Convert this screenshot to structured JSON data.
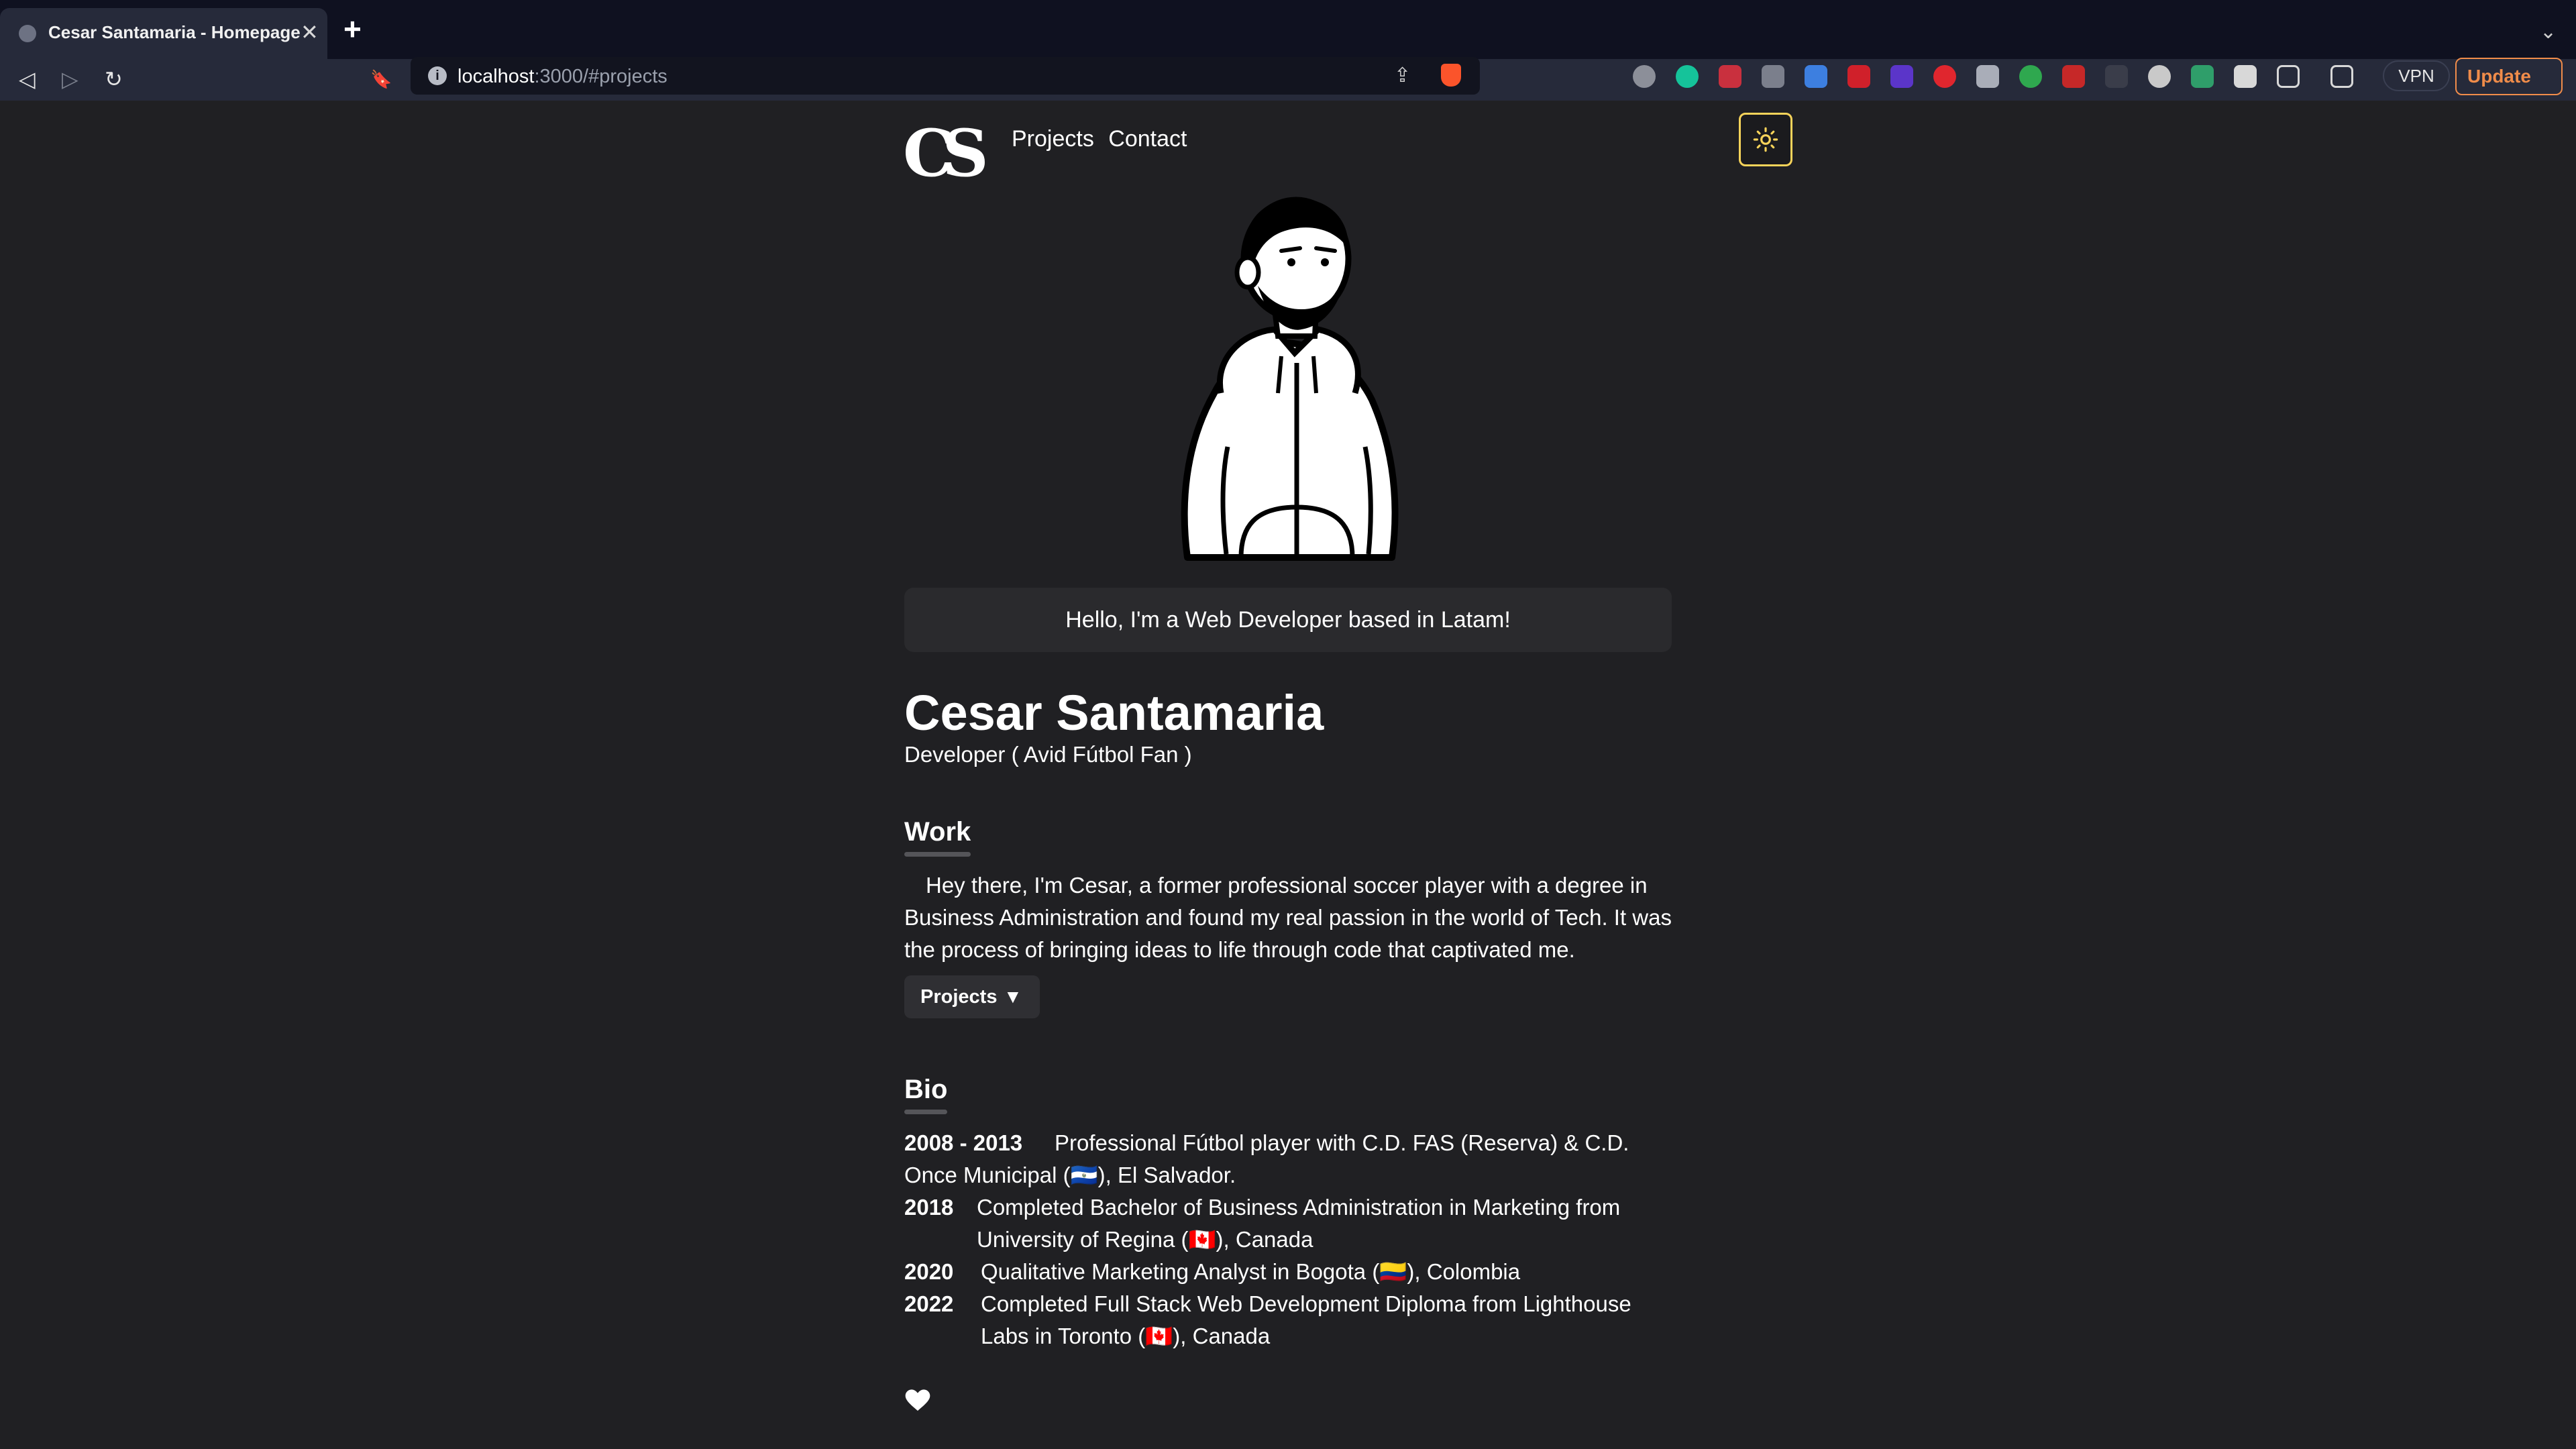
{
  "browser": {
    "tab_title": "Cesar Santamaria - Homepage",
    "tab_close": "✕",
    "new_tab": "+",
    "url_host": "localhost",
    "url_path": ":3000/#projects",
    "vpn_label": "VPN",
    "update_label": "Update",
    "back_icon": "◁",
    "forward_icon": "▷",
    "reload_icon": "↻",
    "bookmark_icon": "🔖",
    "share_icon": "⇪",
    "chevron": "⌄"
  },
  "nav": {
    "logo": "CS",
    "links": [
      "Projects",
      "Contact"
    ]
  },
  "hero": {
    "greeting": "Hello, I'm a Web Developer based in Latam!"
  },
  "profile": {
    "name": "Cesar Santamaria",
    "subtitle": "Developer ( Avid Fútbol Fan )"
  },
  "work": {
    "title": "Work",
    "paragraph": "Hey there, I'm Cesar, a former professional soccer player with a degree in Business Administration and found my real passion in the world of Tech. It was the process of bringing ideas to life through code that captivated me.",
    "projects_button": "Projects",
    "projects_caret": "▼"
  },
  "bio": {
    "title": "Bio",
    "entries": [
      {
        "year": "2008 - 2013",
        "text": "Professional Fútbol player with C.D. FAS (Reserva) & C.D. Once Municipal (🇸🇻), El Salvador."
      },
      {
        "year": "2018",
        "text": "Completed Bachelor of Business Administration in Marketing from University of Regina (🇨🇦), Canada"
      },
      {
        "year": "2020",
        "text": "Qualitative Marketing Analyst in Bogota (🇨🇴), Colombia"
      },
      {
        "year": "2022",
        "text": "Completed Full Stack Web Development Diploma from Lighthouse Labs in Toronto (🇨🇦), Canada"
      }
    ]
  },
  "colors": {
    "background": "#202023",
    "accent": "#f7d35a",
    "update": "#f08c4a"
  }
}
